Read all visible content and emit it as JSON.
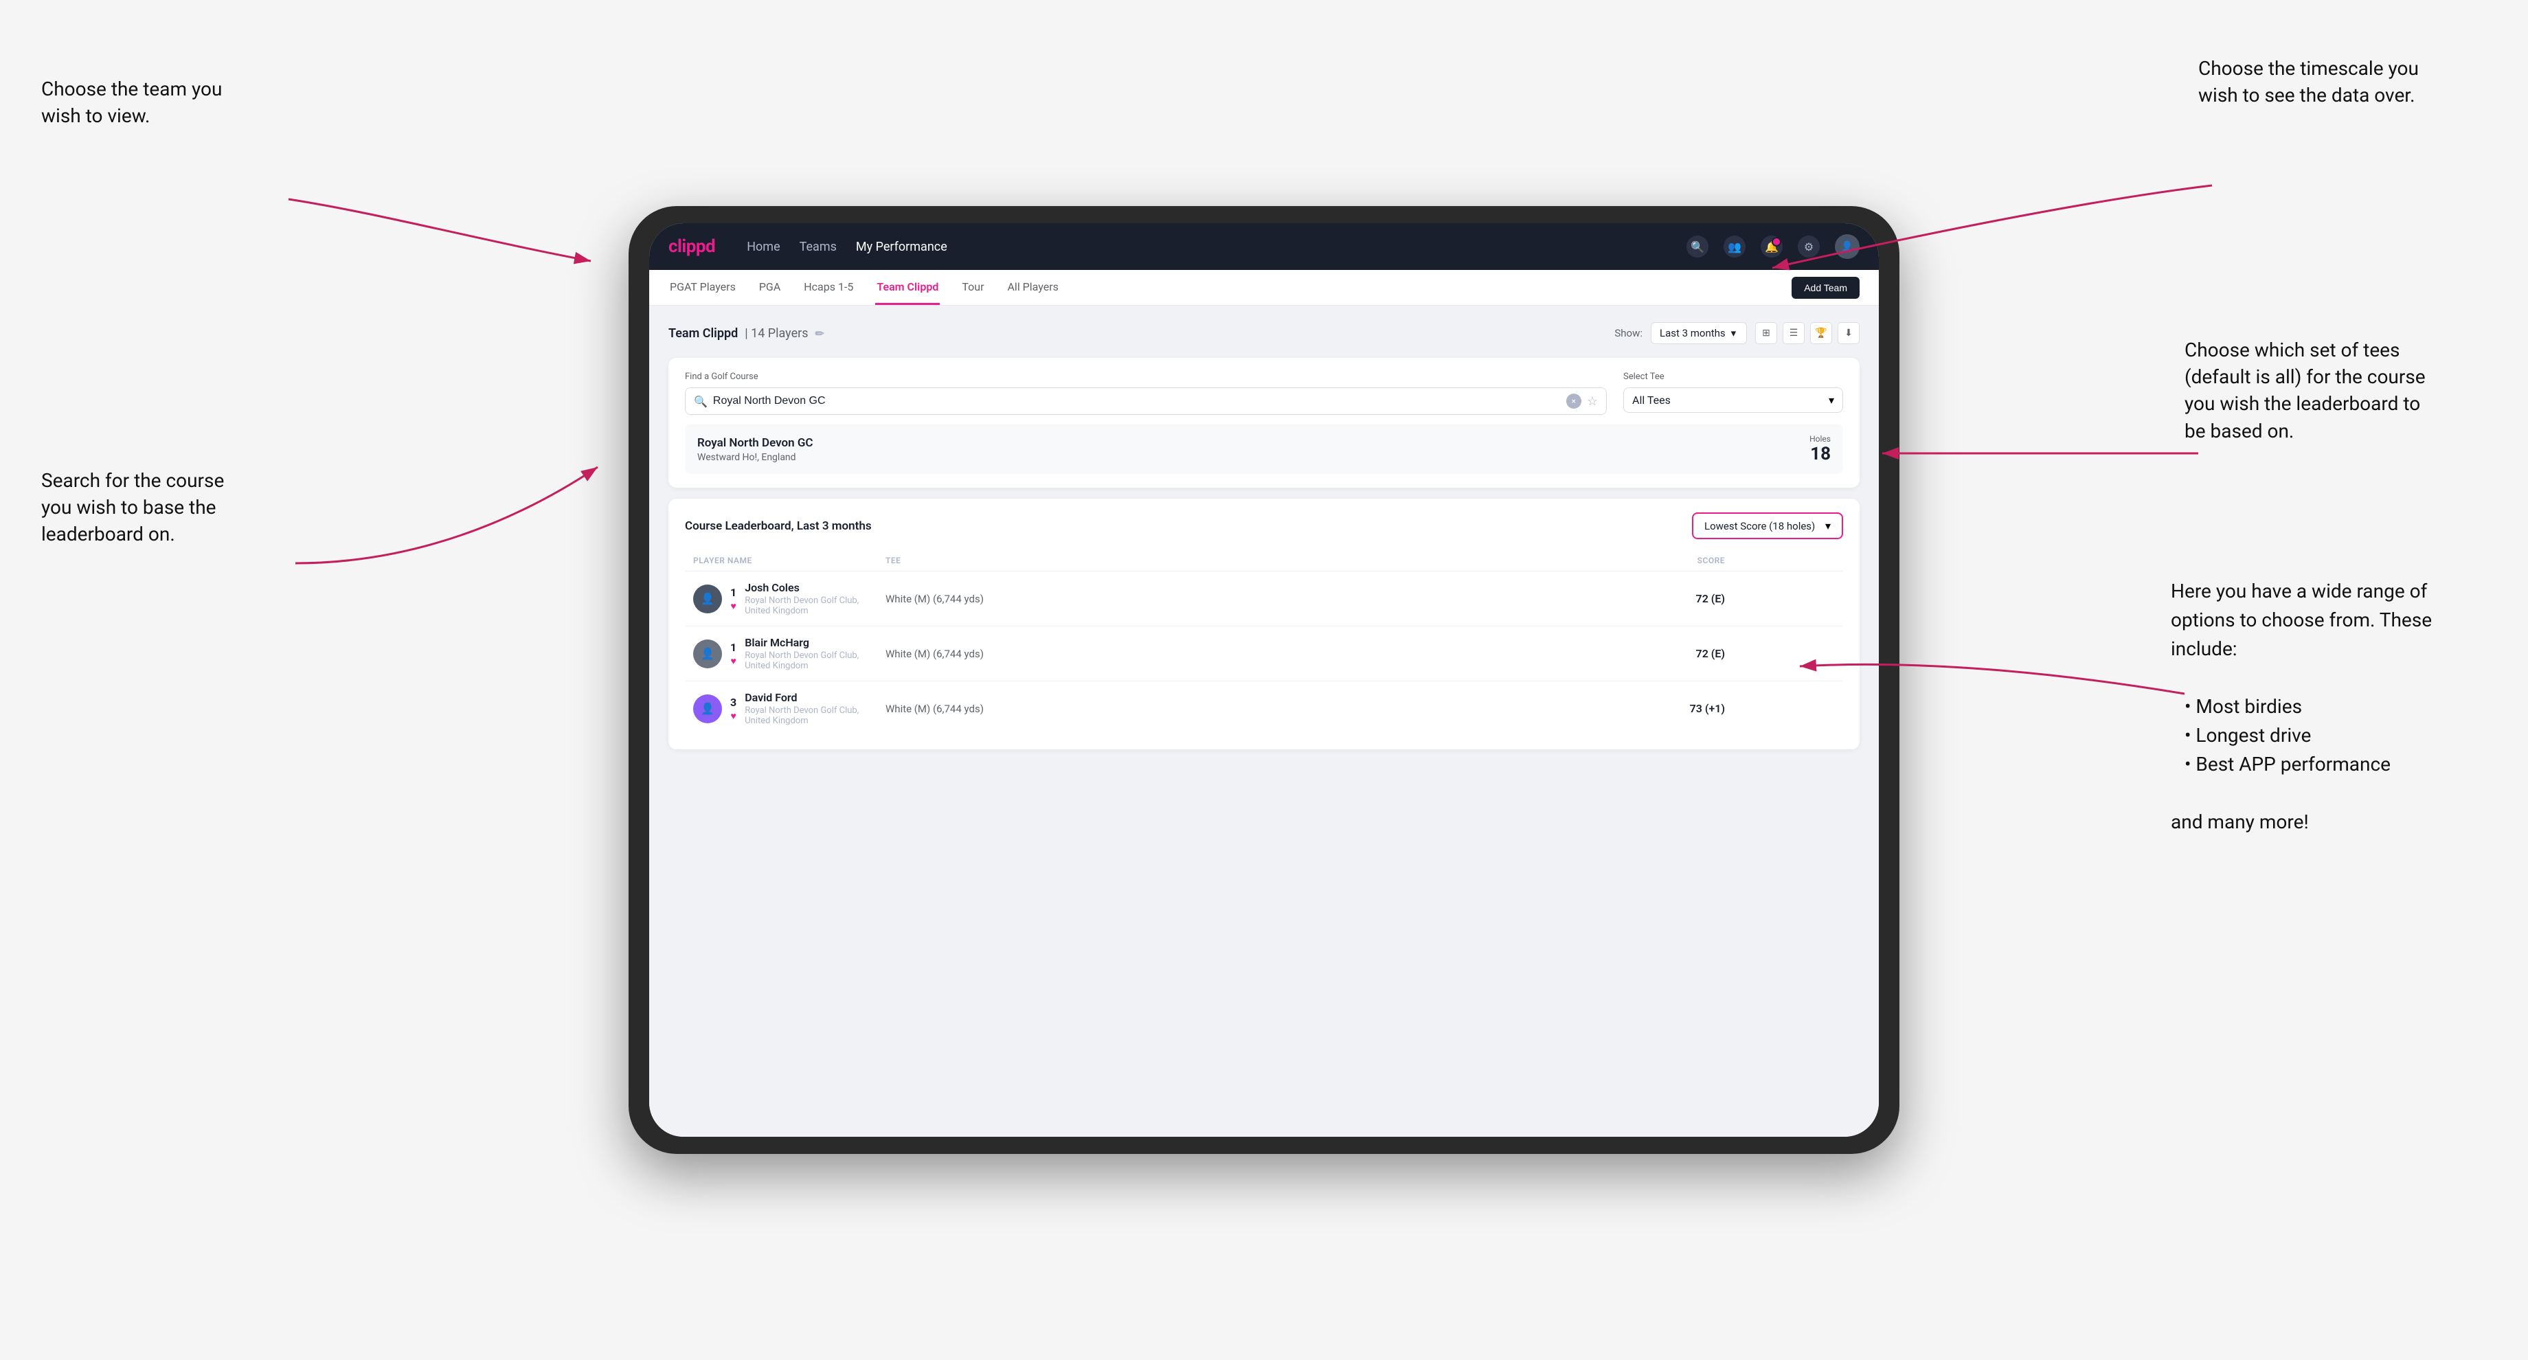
{
  "annotations": {
    "topleft": {
      "line1": "Choose the team you",
      "line2": "wish to view."
    },
    "bottomleft": {
      "line1": "Search for the course",
      "line2": "you wish to base the",
      "line3": "leaderboard on."
    },
    "topright": {
      "line1": "Choose the timescale you",
      "line2": "wish to see the data over."
    },
    "middleright": {
      "line1": "Choose which set of tees",
      "line2": "(default is all) for the course",
      "line3": "you wish the leaderboard to",
      "line4": "be based on."
    },
    "bottomright": {
      "intro": "Here you have a wide range of options to choose from. These include:",
      "bullet1": "Most birdies",
      "bullet2": "Longest drive",
      "bullet3": "Best APP performance",
      "outro": "and many more!"
    }
  },
  "navbar": {
    "logo": "clippd",
    "links": [
      {
        "label": "Home",
        "active": false
      },
      {
        "label": "Teams",
        "active": false
      },
      {
        "label": "My Performance",
        "active": true
      }
    ]
  },
  "subnav": {
    "items": [
      {
        "label": "PGAT Players",
        "active": false
      },
      {
        "label": "PGA",
        "active": false
      },
      {
        "label": "Hcaps 1-5",
        "active": false
      },
      {
        "label": "Team Clippd",
        "active": true
      },
      {
        "label": "Tour",
        "active": false
      },
      {
        "label": "All Players",
        "active": false
      }
    ],
    "add_team_label": "Add Team"
  },
  "team": {
    "name": "Team Clippd",
    "player_count": "14 Players",
    "show_label": "Show:",
    "show_value": "Last 3 months"
  },
  "search": {
    "label": "Find a Golf Course",
    "placeholder": "Royal North Devon GC",
    "value": "Royal North Devon GC"
  },
  "tee": {
    "label": "Select Tee",
    "value": "All Tees"
  },
  "course_result": {
    "name": "Royal North Devon GC",
    "location": "Westward Ho!, England",
    "holes_label": "Holes",
    "holes_value": "18"
  },
  "leaderboard": {
    "title": "Course Leaderboard,",
    "subtitle": "Last 3 months",
    "filter_label": "Lowest Score (18 holes)",
    "columns": {
      "player": "PLAYER NAME",
      "tee": "TEE",
      "score": "SCORE"
    },
    "rows": [
      {
        "rank": "1",
        "name": "Josh Coles",
        "club": "Royal North Devon Golf Club, United Kingdom",
        "tee": "White (M) (6,744 yds)",
        "score": "72 (E)"
      },
      {
        "rank": "1",
        "name": "Blair McHarg",
        "club": "Royal North Devon Golf Club, United Kingdom",
        "tee": "White (M) (6,744 yds)",
        "score": "72 (E)"
      },
      {
        "rank": "3",
        "name": "David Ford",
        "club": "Royal North Devon Golf Club, United Kingdom",
        "tee": "White (M) (6,744 yds)",
        "score": "73 (+1)"
      }
    ]
  }
}
